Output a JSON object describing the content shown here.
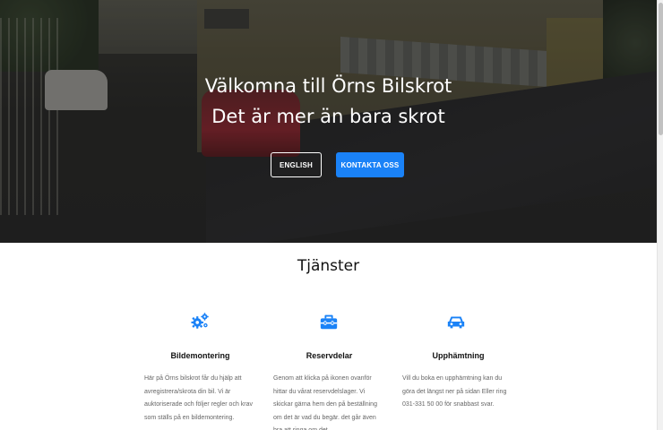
{
  "hero": {
    "title_line1": "Välkomna till Örns Bilskrot",
    "title_line2": "Det är mer än bara skrot",
    "english_button": "ENGLISH",
    "contact_button": "KONTAKTA OSS"
  },
  "services": {
    "heading": "Tjänster",
    "items": [
      {
        "icon": "gears-icon",
        "title": "Bildemontering",
        "text": "Här på Örns bilskrot får du hjälp att avregistrera/skrota din bil. Vi är auktoriserade och följer regler och krav som ställs på en bildemontering."
      },
      {
        "icon": "toolbox-icon",
        "title": "Reservdelar",
        "text": "Genom att klicka på ikonen ovanför hittar du vårat reservdelslager. Vi skickar gärna hem den på beställning om det är vad du begär. det går även bra att ringa om det"
      },
      {
        "icon": "car-icon",
        "title": "Upphämtning",
        "text": "Vill du boka en upphämtning kan du göra det längst ner på sidan Eller ring 031-331 50 00 för snabbast svar."
      }
    ]
  },
  "colors": {
    "accent": "#1a82f7",
    "text_dark": "#111111",
    "text_muted": "#666666"
  }
}
